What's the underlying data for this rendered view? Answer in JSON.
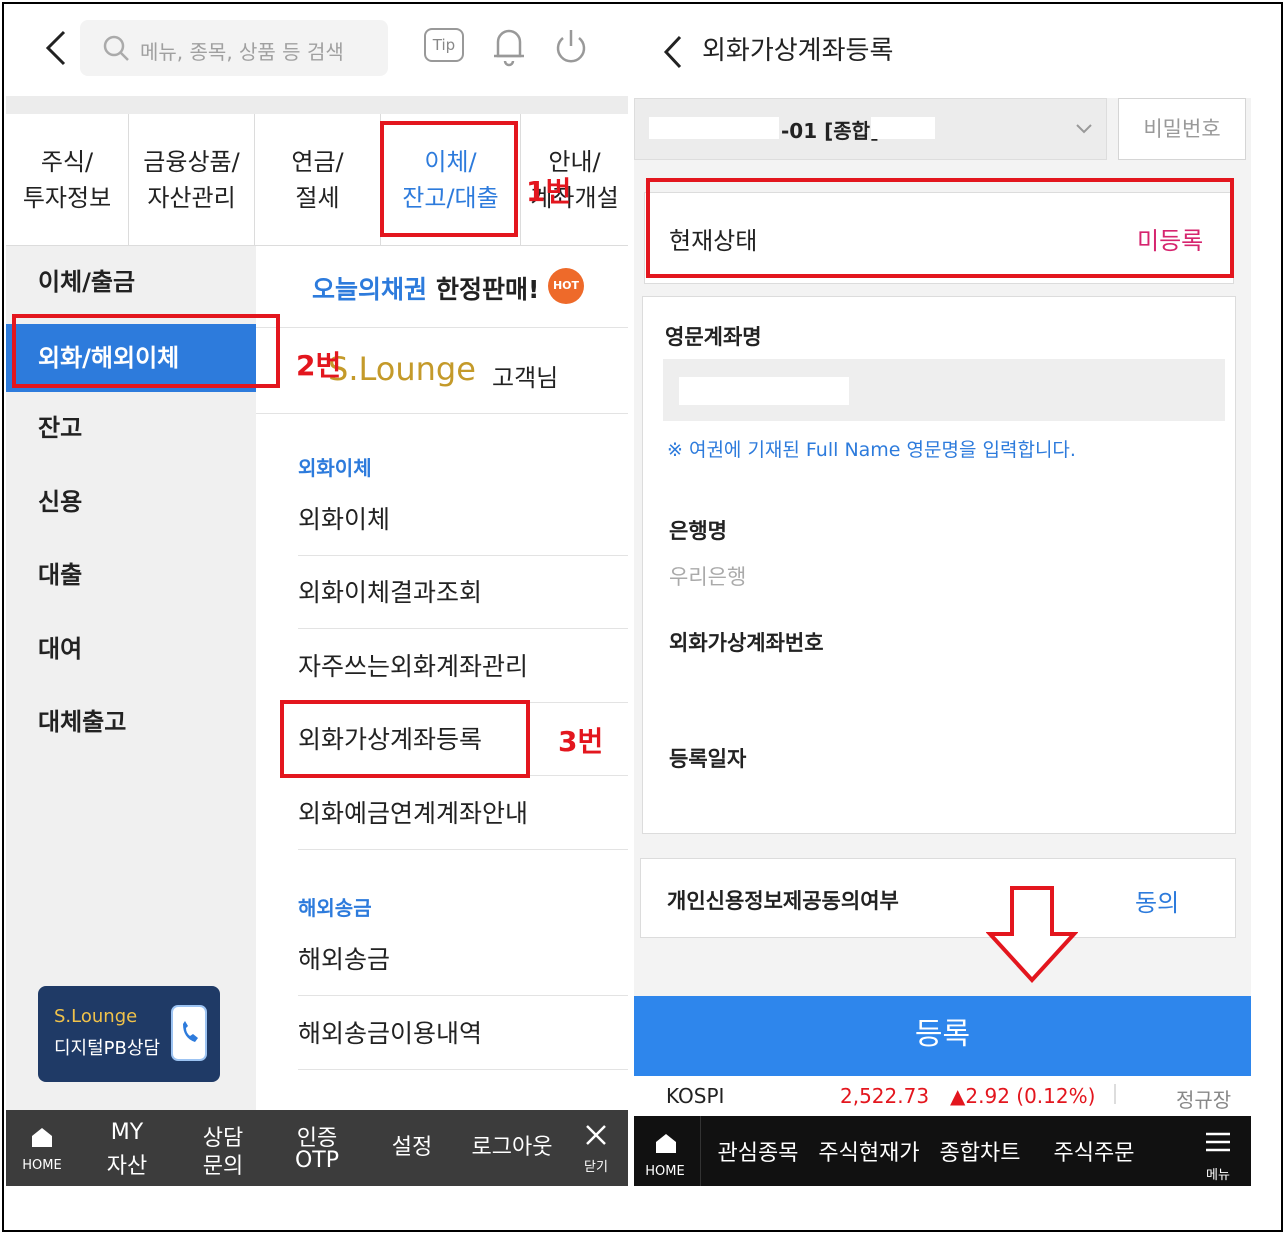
{
  "left": {
    "search_placeholder": "메뉴, 종목, 상품 등 검색",
    "tip_label": "Tip",
    "tabs": [
      {
        "line1": "주식/",
        "line2": "투자정보"
      },
      {
        "line1": "금융상품/",
        "line2": "자산관리"
      },
      {
        "line1": "연금/",
        "line2": "절세"
      },
      {
        "line1": "이체/",
        "line2": "잔고/대출"
      },
      {
        "line1": "안내/",
        "line2": "계좌개설"
      }
    ],
    "nav": [
      "이체/출금",
      "외화/해외이체",
      "잔고",
      "신용",
      "대출",
      "대여",
      "대체출고"
    ],
    "promo": {
      "part1": "오늘의채권",
      "part2": "한정판매!",
      "badge": "HOT"
    },
    "slounge": {
      "brand": "S.Lounge",
      "suffix": "고객님"
    },
    "section1": {
      "title": "외화이체",
      "items": [
        "외화이체",
        "외화이체결과조회",
        "자주쓰는외화계좌관리",
        "외화가상계좌등록",
        "외화예금연계계좌안내"
      ]
    },
    "section2": {
      "title": "해외송금",
      "items": [
        "해외송금",
        "해외송금이용내역"
      ]
    },
    "card": {
      "brand": "S.Lounge",
      "sub": "디지털PB상담"
    },
    "bottom": {
      "home": "HOME",
      "my1": "MY",
      "my2": "자산",
      "c1": "상담",
      "c2": "문의",
      "o1": "인증",
      "o2": "OTP",
      "settings": "설정",
      "logout": "로그아웃",
      "close": "닫기"
    }
  },
  "right": {
    "title": "외화가상계좌등록",
    "account_partial": "-01 [종합]",
    "password_label": "비밀번호",
    "status_label": "현재상태",
    "status_value": "미등록",
    "eng_name_label": "영문계좌명",
    "eng_name_hint": "※ 여권에 기재된 Full Name 영문명을 입력합니다.",
    "bank_label": "은행명",
    "bank_value": "우리은행",
    "vacct_label": "외화가상계좌번호",
    "reg_date_label": "등록일자",
    "consent_label": "개인신용정보제공동의여부",
    "consent_value": "동의",
    "register_label": "등록",
    "ticker": {
      "name": "KOSPI",
      "value": "2,522.73",
      "change": "▲2.92 (0.12%)",
      "session": "정규장"
    },
    "bottom": {
      "home": "HOME",
      "items": [
        "관심종목",
        "주식현재가",
        "종합차트",
        "주식주문"
      ],
      "menu": "메뉴"
    }
  },
  "annotations": {
    "step1": "1번",
    "step2": "2번",
    "step3": "3번"
  },
  "colors": {
    "accent_blue": "#2d7bdc",
    "button_blue": "#2e86ec",
    "annotation_red": "#e3161e",
    "status_pink": "#d6246e",
    "price_red": "#e3161e"
  }
}
